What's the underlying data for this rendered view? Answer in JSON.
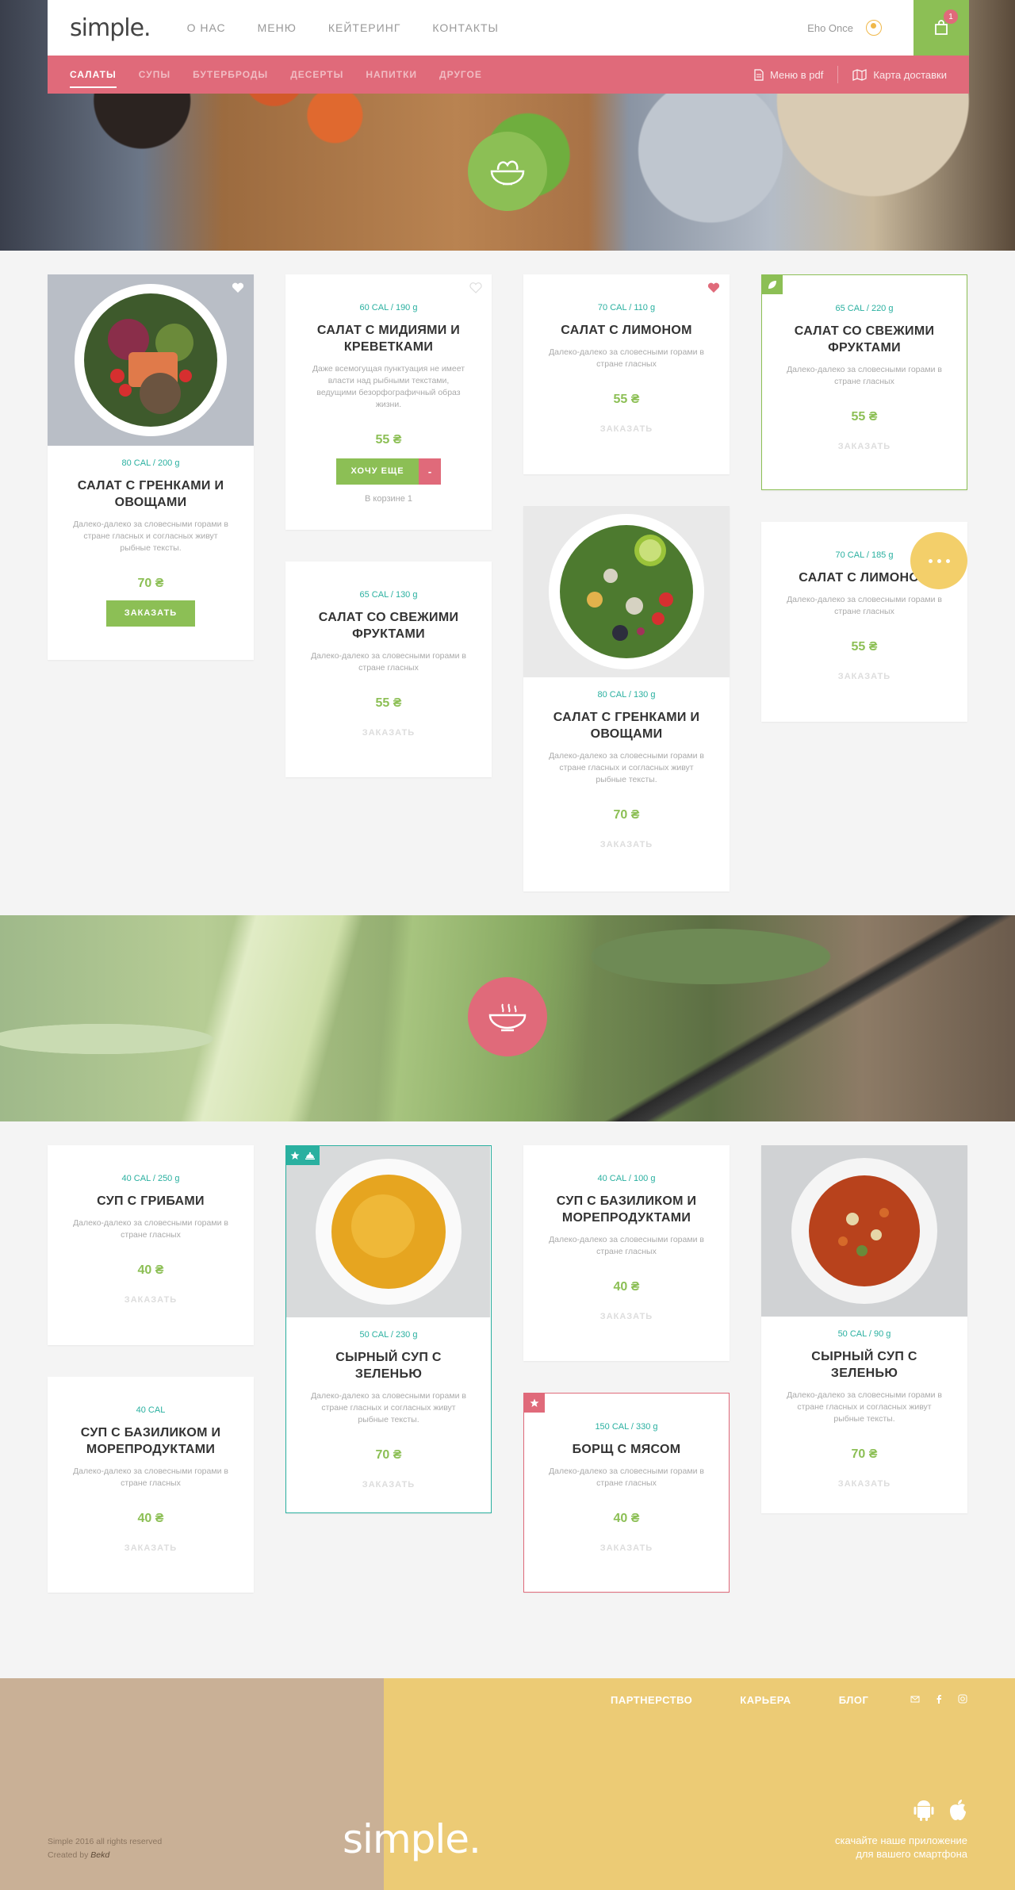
{
  "header": {
    "logo": "simple.",
    "nav": [
      "О НАС",
      "МЕНЮ",
      "КЕЙТЕРИНГ",
      "КОНТАКТЫ"
    ],
    "user_name": "Eho Once",
    "cart_count": "1"
  },
  "categories": {
    "items": [
      "САЛАТЫ",
      "СУПЫ",
      "БУТЕРБРОДЫ",
      "ДЕСЕРТЫ",
      "НАПИТКИ",
      "ДРУГОЕ"
    ],
    "active": "САЛАТЫ",
    "menu_pdf": "Меню в pdf",
    "delivery_map": "Карта доставки"
  },
  "salads": [
    {
      "meta": "80 CAL / 200 g",
      "title": "САЛАТ С ГРЕНКАМИ И ОВОЩАМИ",
      "desc": "Далеко-далеко за словесными горами в стране гласных и согласных живут рыбные тексты.",
      "price": "70 ₴",
      "order": "ЗАКАЗАТЬ"
    },
    {
      "meta": "60 CAL / 190 g",
      "title": "САЛАТ С МИДИЯМИ И КРЕВЕТКАМИ",
      "desc": "Даже всемогущая пунктуация не имеет власти над рыбными текстами, ведущими безорфографичный образ жизни.",
      "price": "55 ₴",
      "more_label": "ХОЧУ ЕЩЕ",
      "minus": "-",
      "in_cart": "В корзине 1"
    },
    {
      "meta": "70 CAL / 110 g",
      "title": "САЛАТ С ЛИМОНОМ",
      "desc": "Далеко-далеко за словесными горами в стране гласных",
      "price": "55 ₴",
      "order": "ЗАКАЗАТЬ"
    },
    {
      "meta": "65 CAL / 220 g",
      "title": "САЛАТ СО СВЕЖИМИ ФРУКТАМИ",
      "desc": "Далеко-далеко за словесными горами в стране гласных",
      "price": "55 ₴",
      "order": "ЗАКАЗАТЬ"
    },
    {
      "meta": "65 CAL / 130 g",
      "title": "САЛАТ СО СВЕЖИМИ ФРУКТАМИ",
      "desc": "Далеко-далеко за словесными горами в стране гласных",
      "price": "55 ₴",
      "order": "ЗАКАЗАТЬ"
    },
    {
      "meta": "80 CAL / 130 g",
      "title": "САЛАТ С ГРЕНКАМИ И ОВОЩАМИ",
      "desc": "Далеко-далеко за словесными горами в стране гласных и согласных живут рыбные тексты.",
      "price": "70 ₴",
      "order": "ЗАКАЗАТЬ"
    },
    {
      "meta": "70 CAL / 185 g",
      "title": "САЛАТ С ЛИМОНОМ",
      "desc": "Далеко-далеко за словесными горами в стране гласных",
      "price": "55 ₴",
      "order": "ЗАКАЗАТЬ"
    }
  ],
  "soups": [
    {
      "meta": "40 CAL / 250 g",
      "title": "СУП С ГРИБАМИ",
      "desc": "Далеко-далеко за словесными горами в стране гласных",
      "price": "40 ₴",
      "order": "ЗАКАЗАТЬ"
    },
    {
      "meta": "50 CAL / 230 g",
      "title": "СЫРНЫЙ СУП С ЗЕЛЕНЬЮ",
      "desc": "Далеко-далеко за словесными горами в стране гласных и согласных живут рыбные тексты.",
      "price": "70 ₴",
      "order": "ЗАКАЗАТЬ"
    },
    {
      "meta": "40 CAL / 100 g",
      "title": "СУП С БАЗИЛИКОМ И МОРЕПРОДУКТАМИ",
      "desc": "Далеко-далеко за словесными горами в стране гласных",
      "price": "40 ₴",
      "order": "ЗАКАЗАТЬ"
    },
    {
      "meta": "50 CAL / 90 g",
      "title": "СЫРНЫЙ СУП С ЗЕЛЕНЬЮ",
      "desc": "Далеко-далеко за словесными горами в стране гласных и согласных живут рыбные тексты.",
      "price": "70 ₴",
      "order": "ЗАКАЗАТЬ"
    },
    {
      "meta": "40 CAL",
      "title": "СУП С БАЗИЛИКОМ И МОРЕПРОДУКТАМИ",
      "desc": "Далеко-далеко за словесными горами в стране гласных",
      "price": "40 ₴",
      "order": "ЗАКАЗАТЬ"
    },
    {
      "meta": "150 CAL / 330 g",
      "title": "БОРЩ С МЯСОМ",
      "desc": "Далеко-далеко за словесными горами в стране гласных",
      "price": "40 ₴",
      "order": "ЗАКАЗАТЬ"
    }
  ],
  "footer": {
    "links": [
      "ПАРТНЕРСТВО",
      "КАРЬЕРА",
      "БЛОГ"
    ],
    "logo": "simple.",
    "copyright": "Simple 2016 all rights reserved",
    "created_by": "Created by ",
    "created_by_name": "Bekd",
    "app_line1": "скачайте наше приложение",
    "app_line2": "для вашего смартфона"
  },
  "colors": {
    "green": "#8cbf55",
    "pink": "#e06a7a",
    "teal": "#2ab0a0",
    "yellow": "#f3cf6a",
    "footer_left": "#c9b096",
    "footer_right": "#eccb75"
  },
  "icons": [
    "salad-bowl-icon",
    "soup-bowl-icon",
    "cart-bag-icon",
    "user-icon",
    "pdf-icon",
    "map-icon",
    "heart-icon",
    "leaf-icon",
    "star-icon",
    "cloche-icon",
    "more-dots-icon",
    "mail-icon",
    "facebook-icon",
    "instagram-icon",
    "android-icon",
    "apple-icon"
  ]
}
